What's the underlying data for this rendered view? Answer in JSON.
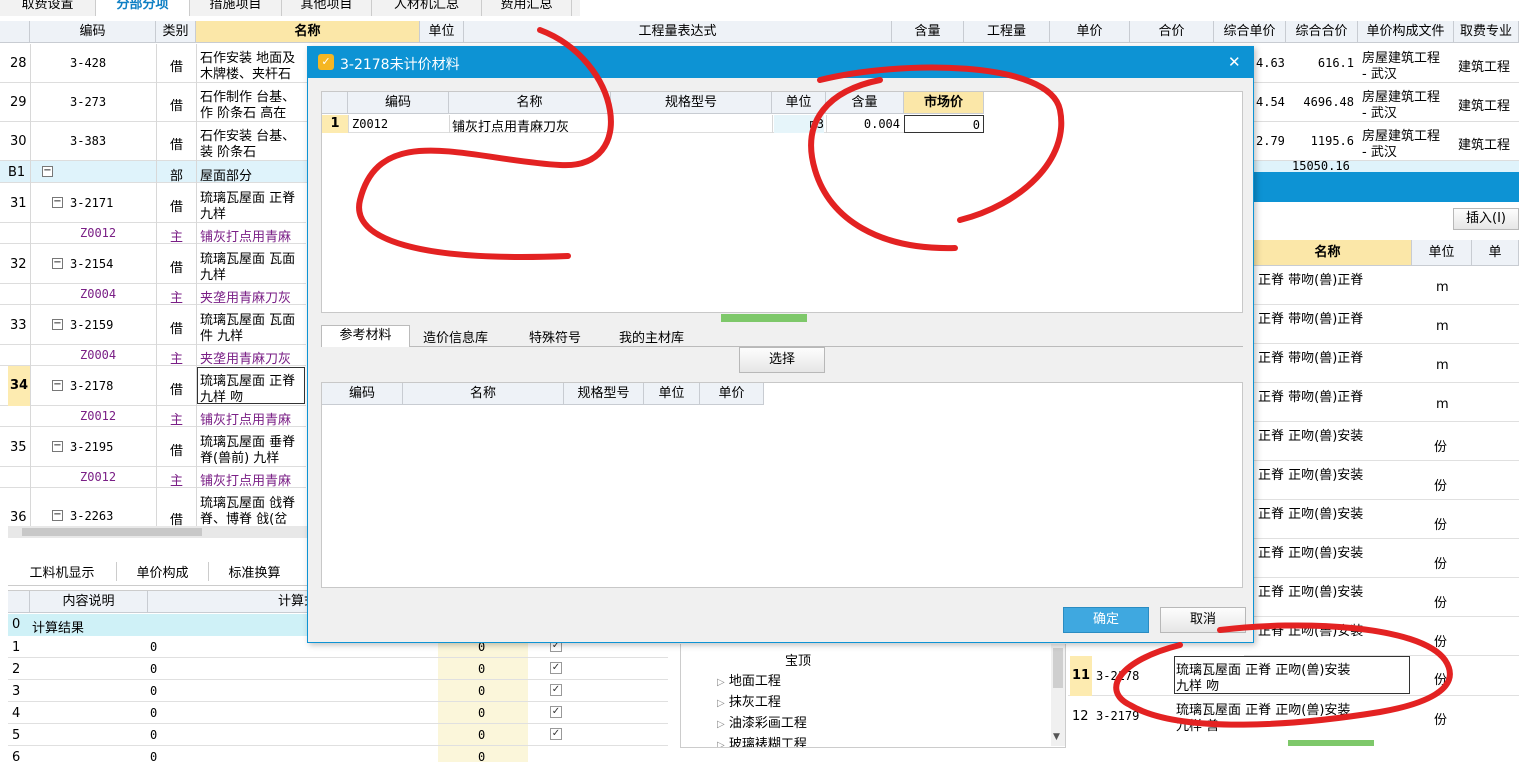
{
  "top_tabs": [
    "取费设置",
    "分部分项",
    "措施项目",
    "其他项目",
    "人材机汇总",
    "费用汇总"
  ],
  "main_headers": [
    "编码",
    "类别",
    "名称",
    "单位",
    "工程量表达式",
    "含量",
    "工程量",
    "单价",
    "合价",
    "综合单价",
    "综合合价",
    "单价构成文件",
    "取费专业"
  ],
  "rows": [
    {
      "n": "28",
      "code": "3-428",
      "type": "借",
      "name1": "石作安装 地面及",
      "name2": "木牌楼、夹杆石",
      "zhdj": "4.63",
      "zhhj": "616.1",
      "file1": "房屋建筑工程",
      "file2": "- 武汉",
      "fee": "建筑工程"
    },
    {
      "n": "29",
      "code": "3-273",
      "type": "借",
      "name1": "石作制作 台基、",
      "name2": "作 阶条石 高在",
      "zhdj": "4.54",
      "zhhj": "4696.48",
      "file1": "房屋建筑工程",
      "file2": "- 武汉",
      "fee": "建筑工程"
    },
    {
      "n": "30",
      "code": "3-383",
      "type": "借",
      "name1": "石作安装 台基、",
      "name2": "装 阶条石",
      "zhdj": "2.79",
      "zhhj": "1195.6",
      "file1": "房屋建筑工程",
      "file2": "- 武汉",
      "fee": "建筑工程"
    },
    {
      "n": "B1",
      "code": "",
      "type": "部",
      "name1": "屋面部分",
      "name2": "",
      "zhdj": "",
      "zhhj": "15050.16",
      "file1": "",
      "file2": "",
      "fee": ""
    },
    {
      "n": "31",
      "code": "3-2171",
      "type": "借",
      "name1": "琉璃瓦屋面 正脊",
      "name2": "九样"
    },
    {
      "n": "",
      "code": "Z0012",
      "type": "主",
      "name1": "铺灰打点用青麻",
      "name2": ""
    },
    {
      "n": "32",
      "code": "3-2154",
      "type": "借",
      "name1": "琉璃瓦屋面 瓦面",
      "name2": "九样"
    },
    {
      "n": "",
      "code": "Z0004",
      "type": "主",
      "name1": "夹垄用青麻刀灰",
      "name2": ""
    },
    {
      "n": "33",
      "code": "3-2159",
      "type": "借",
      "name1": "琉璃瓦屋面 瓦面",
      "name2": "件 九样"
    },
    {
      "n": "",
      "code": "Z0004",
      "type": "主",
      "name1": "夹垄用青麻刀灰",
      "name2": ""
    },
    {
      "n": "34",
      "code": "3-2178",
      "type": "借",
      "name1": "琉璃瓦屋面 正脊",
      "name2": "九样 吻"
    },
    {
      "n": "",
      "code": "Z0012",
      "type": "主",
      "name1": "铺灰打点用青麻",
      "name2": ""
    },
    {
      "n": "35",
      "code": "3-2195",
      "type": "借",
      "name1": "琉璃瓦屋面 垂脊",
      "name2": "脊(兽前) 九样"
    },
    {
      "n": "",
      "code": "Z0012",
      "type": "主",
      "name1": "铺灰打点用青麻",
      "name2": ""
    },
    {
      "n": "36",
      "code": "3-2263",
      "type": "借",
      "name1": "琉璃瓦屋面 戗脊",
      "name2": "脊、博脊 戗(岔"
    }
  ],
  "bottom_tabs": [
    "工料机显示",
    "单价构成",
    "标准换算"
  ],
  "bottom_headers": [
    "内容说明",
    "计算式"
  ],
  "bottom_rows": [
    {
      "n": "0",
      "desc": "计算结果",
      "val": "",
      "qty": ""
    },
    {
      "n": "1",
      "desc": "",
      "val": "0",
      "qty": "0"
    },
    {
      "n": "2",
      "desc": "",
      "val": "0",
      "qty": "0"
    },
    {
      "n": "3",
      "desc": "",
      "val": "0",
      "qty": "0"
    },
    {
      "n": "4",
      "desc": "",
      "val": "0",
      "qty": "0"
    },
    {
      "n": "5",
      "desc": "",
      "val": "0",
      "qty": "0"
    },
    {
      "n": "6",
      "desc": "",
      "val": "0",
      "qty": "0"
    }
  ],
  "tree_items": [
    "宝顶",
    "地面工程",
    "抹灰工程",
    "油漆彩画工程",
    "玻璃裱糊工程"
  ],
  "right_panel": {
    "insert_label": "插入(I)",
    "headers": [
      "名称",
      "单位",
      "单"
    ],
    "rows": [
      {
        "name": "正脊 带吻(兽)正脊",
        "unit": "m"
      },
      {
        "name": "正脊 带吻(兽)正脊",
        "unit": "m"
      },
      {
        "name": "正脊 带吻(兽)正脊",
        "unit": "m"
      },
      {
        "name": "正脊 带吻(兽)正脊",
        "unit": "m"
      },
      {
        "name": "正脊 正吻(兽)安装",
        "unit": "份"
      },
      {
        "name": "正脊 正吻(兽)安装",
        "unit": "份"
      },
      {
        "name": "正脊 正吻(兽)安装",
        "unit": "份"
      },
      {
        "name": "正脊 正吻(兽)安装",
        "unit": "份"
      },
      {
        "name": "正脊 正吻(兽)安装",
        "unit": "份"
      },
      {
        "name": "正脊 正吻(兽)安装",
        "unit": "份"
      }
    ],
    "row11": {
      "n": "11",
      "code": "3-2178",
      "name1": "琉璃瓦屋面 正脊 正吻(兽)安装",
      "name2": "九样 吻",
      "unit": "份"
    },
    "row12": {
      "n": "12",
      "code": "3-2179",
      "name1": "琉璃瓦屋面 正脊 正吻(兽)安装",
      "name2": "九样 兽",
      "unit": "份"
    }
  },
  "dialog": {
    "title": "3-2178未计价材料",
    "close": "✕",
    "headers": [
      "编码",
      "名称",
      "规格型号",
      "单位",
      "含量",
      "市场价"
    ],
    "row": {
      "n": "1",
      "code": "Z0012",
      "name": "铺灰打点用青麻刀灰",
      "spec": "",
      "unit": "m3",
      "qty": "0.004",
      "price": "0"
    },
    "sub_tabs": [
      "参考材料",
      "造价信息库",
      "特殊符号",
      "我的主材库"
    ],
    "select_label": "选择",
    "ref_headers": [
      "编码",
      "名称",
      "规格型号",
      "单位",
      "单价"
    ],
    "ok_label": "确定",
    "cancel_label": "取消"
  },
  "colors": {
    "accent": "#0d93d4",
    "header_bg": "#eef2f7",
    "ok_btn": "#3fa8e0",
    "annotation": "#e32222"
  }
}
